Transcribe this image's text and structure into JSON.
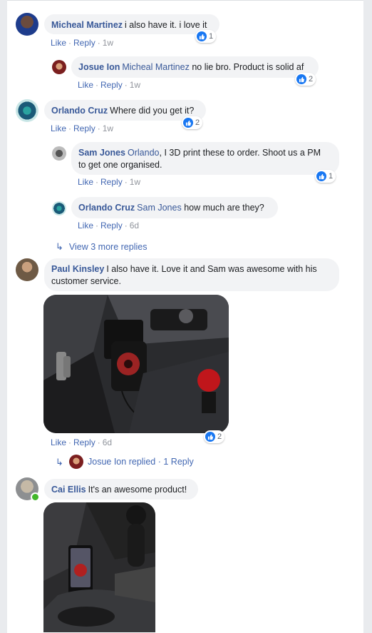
{
  "comments": [
    {
      "author": "Micheal Martinez",
      "text": "i also have it. i love it",
      "actions": {
        "like": "Like",
        "reply": "Reply",
        "time": "1w"
      },
      "reactions": "1"
    },
    {
      "author": "Josue Ion",
      "mention": "Micheal Martinez",
      "text": "no lie bro. Product is solid af",
      "actions": {
        "like": "Like",
        "reply": "Reply",
        "time": "1w"
      },
      "reactions": "2"
    },
    {
      "author": "Orlando Cruz",
      "text": "Where did you get it?",
      "actions": {
        "like": "Like",
        "reply": "Reply",
        "time": "1w"
      },
      "reactions": "2"
    },
    {
      "author": "Sam Jones",
      "mention": "Orlando",
      "text_line1": ", I 3D print these to order. Shoot us a PM",
      "text_line2": "to get one organised.",
      "actions": {
        "like": "Like",
        "reply": "Reply",
        "time": "1w"
      },
      "reactions": "1"
    },
    {
      "author": "Orlando Cruz",
      "mention": "Sam Jones",
      "text": "how much are they?",
      "actions": {
        "like": "Like",
        "reply": "Reply",
        "time": "6d"
      }
    },
    {
      "author": "Paul Kinsley",
      "text_line1": "I also have it. Love it and Sam was awesome with his",
      "text_line2": "customer service.",
      "actions": {
        "like": "Like",
        "reply": "Reply",
        "time": "6d"
      },
      "reactions": "2"
    },
    {
      "author": "Cai Ellis",
      "text": "It's an awesome product!"
    }
  ],
  "view_more": "View 3 more replies",
  "replied": {
    "name": "Josue Ion",
    "text": "replied",
    "separator": "·",
    "count": "1 Reply"
  },
  "icons": {
    "like": "thumbs-up-icon",
    "reply_arrow": "reply-arrow-icon"
  },
  "colors": {
    "link": "#385898",
    "action": "#4267b2",
    "like": "#1877f2",
    "bubble": "#f2f3f5",
    "online": "#42b72a"
  }
}
